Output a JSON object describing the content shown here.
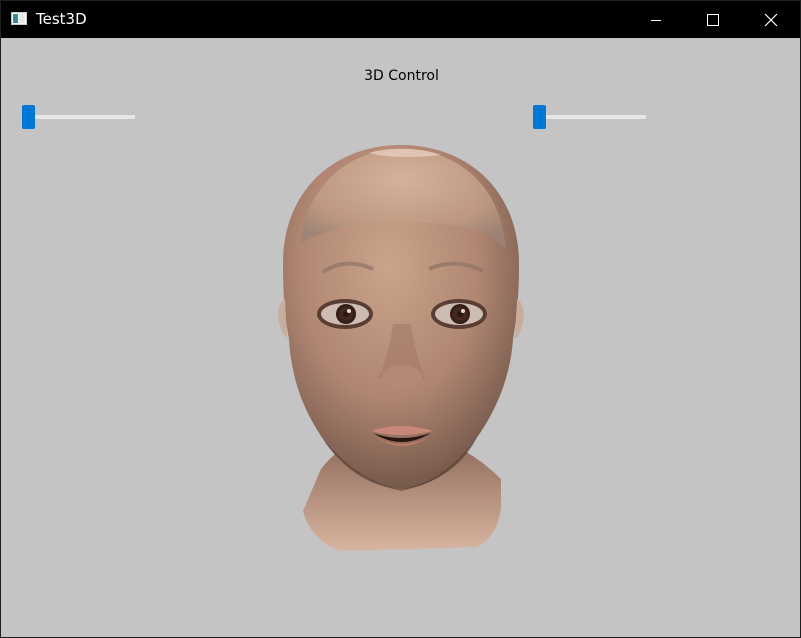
{
  "window": {
    "title": "Test3D"
  },
  "titlebar": {
    "icon": "app-window-icon",
    "buttons": [
      "minimize-icon",
      "maximize-icon",
      "close-icon"
    ]
  },
  "content": {
    "label": "3D Control",
    "sliders": [
      {
        "id": "left",
        "value_fraction": 0.0
      },
      {
        "id": "right",
        "value_fraction": 0.0
      }
    ]
  },
  "colors": {
    "background": "#c4c4c4",
    "titlebar": "#000000",
    "slider_accent": "#0078d7",
    "slider_track": "#e6e6e6"
  }
}
